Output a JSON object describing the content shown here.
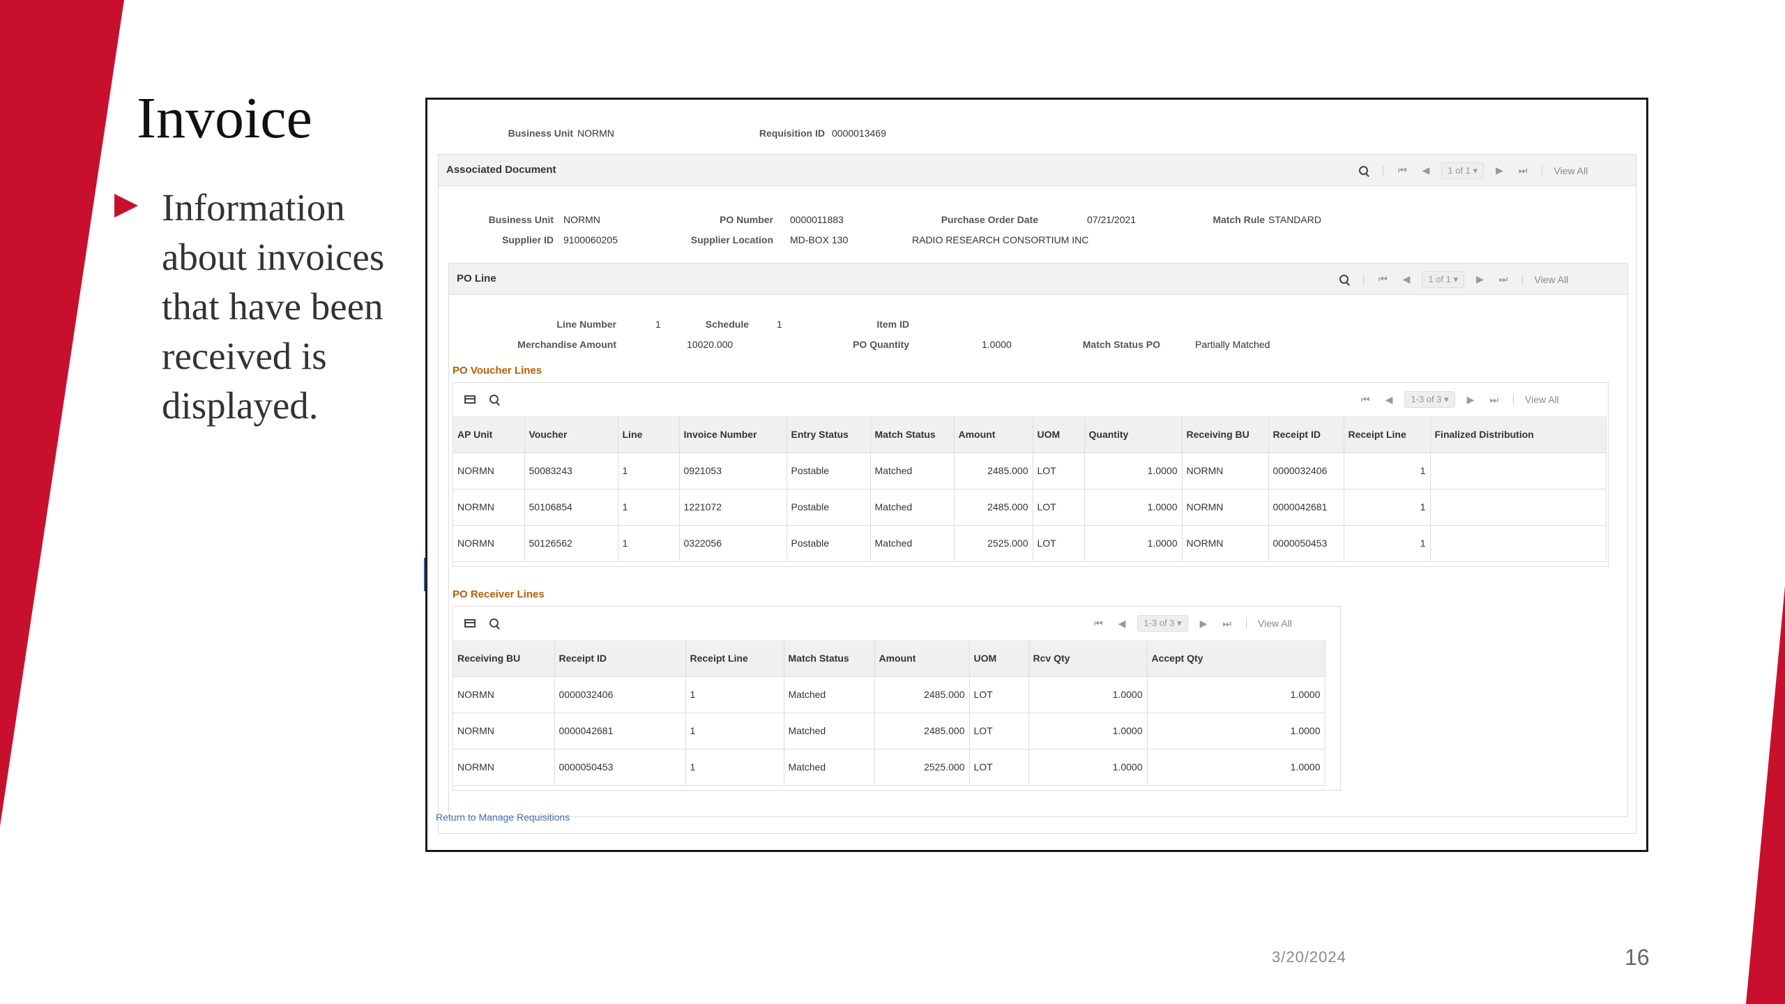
{
  "slide": {
    "title": "Invoice",
    "bullet": "Information about invoices that have been received is displayed.",
    "date": "3/20/2024",
    "page_number": "16",
    "accent_color": "#c8102e"
  },
  "header": {
    "business_unit_label": "Business Unit",
    "business_unit_value": "NORMN",
    "requisition_id_label": "Requisition ID",
    "requisition_id_value": "0000013469"
  },
  "associated_document": {
    "title": "Associated Document",
    "pager": "1 of 1",
    "view_all": "View All",
    "fields": {
      "business_unit_label": "Business Unit",
      "business_unit_value": "NORMN",
      "po_number_label": "PO Number",
      "po_number_value": "0000011883",
      "po_date_label": "Purchase Order Date",
      "po_date_value": "07/21/2021",
      "match_rule_label": "Match Rule",
      "match_rule_value": "STANDARD",
      "supplier_id_label": "Supplier ID",
      "supplier_id_value": "9100060205",
      "supplier_location_label": "Supplier Location",
      "supplier_location_value": "MD-BOX 130",
      "supplier_name": "RADIO RESEARCH CONSORTIUM INC"
    }
  },
  "po_line": {
    "title": "PO Line",
    "pager": "1 of 1",
    "view_all": "View All",
    "fields": {
      "line_number_label": "Line Number",
      "line_number_value": "1",
      "schedule_label": "Schedule",
      "schedule_value": "1",
      "item_id_label": "Item ID",
      "merch_amount_label": "Merchandise Amount",
      "merch_amount_value": "10020.000",
      "po_quantity_label": "PO Quantity",
      "po_quantity_value": "1.0000",
      "match_status_label": "Match Status PO",
      "match_status_value": "Partially Matched"
    }
  },
  "voucher_lines": {
    "title": "PO Voucher Lines",
    "pager": "1-3 of 3",
    "view_all": "View All",
    "columns": [
      "AP Unit",
      "Voucher",
      "Line",
      "Invoice Number",
      "Entry Status",
      "Match Status",
      "Amount",
      "UOM",
      "Quantity",
      "Receiving BU",
      "Receipt ID",
      "Receipt Line",
      "Finalized Distribution"
    ],
    "rows": [
      [
        "NORMN",
        "50083243",
        "1",
        "0921053",
        "Postable",
        "Matched",
        "2485.000",
        "LOT",
        "1.0000",
        "NORMN",
        "0000032406",
        "1",
        ""
      ],
      [
        "NORMN",
        "50106854",
        "1",
        "1221072",
        "Postable",
        "Matched",
        "2485.000",
        "LOT",
        "1.0000",
        "NORMN",
        "0000042681",
        "1",
        ""
      ],
      [
        "NORMN",
        "50126562",
        "1",
        "0322056",
        "Postable",
        "Matched",
        "2525.000",
        "LOT",
        "1.0000",
        "NORMN",
        "0000050453",
        "1",
        ""
      ]
    ]
  },
  "receiver_lines": {
    "title": "PO Receiver Lines",
    "pager": "1-3 of 3",
    "view_all": "View All",
    "columns": [
      "Receiving BU",
      "Receipt ID",
      "Receipt Line",
      "Match Status",
      "Amount",
      "UOM",
      "Rcv Qty",
      "Accept Qty"
    ],
    "rows": [
      [
        "NORMN",
        "0000032406",
        "1",
        "Matched",
        "2485.000",
        "LOT",
        "1.0000",
        "1.0000"
      ],
      [
        "NORMN",
        "0000042681",
        "1",
        "Matched",
        "2485.000",
        "LOT",
        "1.0000",
        "1.0000"
      ],
      [
        "NORMN",
        "0000050453",
        "1",
        "Matched",
        "2525.000",
        "LOT",
        "1.0000",
        "1.0000"
      ]
    ]
  },
  "return_link": "Return to Manage Requisitions"
}
